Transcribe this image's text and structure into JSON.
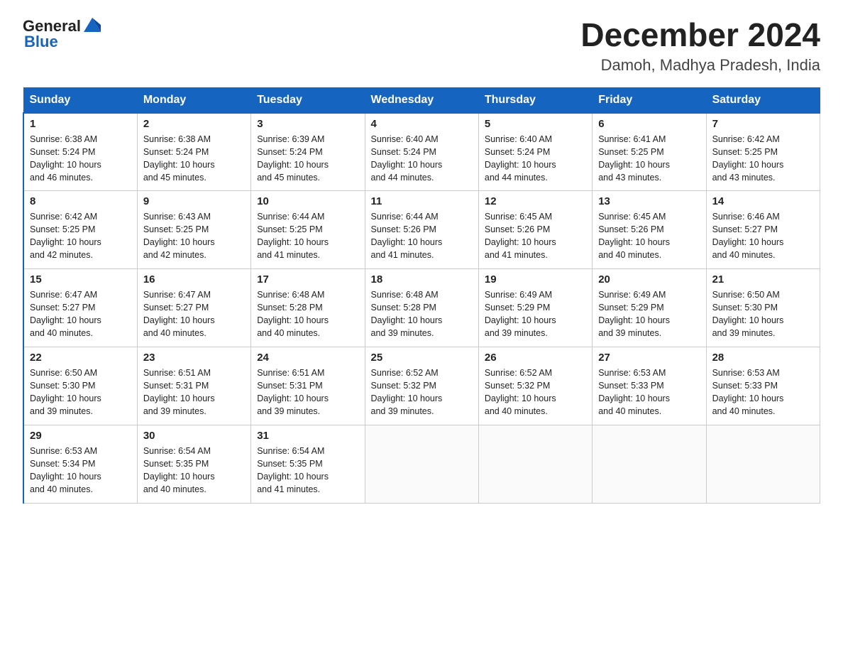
{
  "header": {
    "logo_general": "General",
    "logo_blue": "Blue",
    "title": "December 2024",
    "subtitle": "Damoh, Madhya Pradesh, India"
  },
  "days_of_week": [
    "Sunday",
    "Monday",
    "Tuesday",
    "Wednesday",
    "Thursday",
    "Friday",
    "Saturday"
  ],
  "weeks": [
    [
      {
        "day": "1",
        "sunrise": "6:38 AM",
        "sunset": "5:24 PM",
        "daylight": "10 hours and 46 minutes."
      },
      {
        "day": "2",
        "sunrise": "6:38 AM",
        "sunset": "5:24 PM",
        "daylight": "10 hours and 45 minutes."
      },
      {
        "day": "3",
        "sunrise": "6:39 AM",
        "sunset": "5:24 PM",
        "daylight": "10 hours and 45 minutes."
      },
      {
        "day": "4",
        "sunrise": "6:40 AM",
        "sunset": "5:24 PM",
        "daylight": "10 hours and 44 minutes."
      },
      {
        "day": "5",
        "sunrise": "6:40 AM",
        "sunset": "5:24 PM",
        "daylight": "10 hours and 44 minutes."
      },
      {
        "day": "6",
        "sunrise": "6:41 AM",
        "sunset": "5:25 PM",
        "daylight": "10 hours and 43 minutes."
      },
      {
        "day": "7",
        "sunrise": "6:42 AM",
        "sunset": "5:25 PM",
        "daylight": "10 hours and 43 minutes."
      }
    ],
    [
      {
        "day": "8",
        "sunrise": "6:42 AM",
        "sunset": "5:25 PM",
        "daylight": "10 hours and 42 minutes."
      },
      {
        "day": "9",
        "sunrise": "6:43 AM",
        "sunset": "5:25 PM",
        "daylight": "10 hours and 42 minutes."
      },
      {
        "day": "10",
        "sunrise": "6:44 AM",
        "sunset": "5:25 PM",
        "daylight": "10 hours and 41 minutes."
      },
      {
        "day": "11",
        "sunrise": "6:44 AM",
        "sunset": "5:26 PM",
        "daylight": "10 hours and 41 minutes."
      },
      {
        "day": "12",
        "sunrise": "6:45 AM",
        "sunset": "5:26 PM",
        "daylight": "10 hours and 41 minutes."
      },
      {
        "day": "13",
        "sunrise": "6:45 AM",
        "sunset": "5:26 PM",
        "daylight": "10 hours and 40 minutes."
      },
      {
        "day": "14",
        "sunrise": "6:46 AM",
        "sunset": "5:27 PM",
        "daylight": "10 hours and 40 minutes."
      }
    ],
    [
      {
        "day": "15",
        "sunrise": "6:47 AM",
        "sunset": "5:27 PM",
        "daylight": "10 hours and 40 minutes."
      },
      {
        "day": "16",
        "sunrise": "6:47 AM",
        "sunset": "5:27 PM",
        "daylight": "10 hours and 40 minutes."
      },
      {
        "day": "17",
        "sunrise": "6:48 AM",
        "sunset": "5:28 PM",
        "daylight": "10 hours and 40 minutes."
      },
      {
        "day": "18",
        "sunrise": "6:48 AM",
        "sunset": "5:28 PM",
        "daylight": "10 hours and 39 minutes."
      },
      {
        "day": "19",
        "sunrise": "6:49 AM",
        "sunset": "5:29 PM",
        "daylight": "10 hours and 39 minutes."
      },
      {
        "day": "20",
        "sunrise": "6:49 AM",
        "sunset": "5:29 PM",
        "daylight": "10 hours and 39 minutes."
      },
      {
        "day": "21",
        "sunrise": "6:50 AM",
        "sunset": "5:30 PM",
        "daylight": "10 hours and 39 minutes."
      }
    ],
    [
      {
        "day": "22",
        "sunrise": "6:50 AM",
        "sunset": "5:30 PM",
        "daylight": "10 hours and 39 minutes."
      },
      {
        "day": "23",
        "sunrise": "6:51 AM",
        "sunset": "5:31 PM",
        "daylight": "10 hours and 39 minutes."
      },
      {
        "day": "24",
        "sunrise": "6:51 AM",
        "sunset": "5:31 PM",
        "daylight": "10 hours and 39 minutes."
      },
      {
        "day": "25",
        "sunrise": "6:52 AM",
        "sunset": "5:32 PM",
        "daylight": "10 hours and 39 minutes."
      },
      {
        "day": "26",
        "sunrise": "6:52 AM",
        "sunset": "5:32 PM",
        "daylight": "10 hours and 40 minutes."
      },
      {
        "day": "27",
        "sunrise": "6:53 AM",
        "sunset": "5:33 PM",
        "daylight": "10 hours and 40 minutes."
      },
      {
        "day": "28",
        "sunrise": "6:53 AM",
        "sunset": "5:33 PM",
        "daylight": "10 hours and 40 minutes."
      }
    ],
    [
      {
        "day": "29",
        "sunrise": "6:53 AM",
        "sunset": "5:34 PM",
        "daylight": "10 hours and 40 minutes."
      },
      {
        "day": "30",
        "sunrise": "6:54 AM",
        "sunset": "5:35 PM",
        "daylight": "10 hours and 40 minutes."
      },
      {
        "day": "31",
        "sunrise": "6:54 AM",
        "sunset": "5:35 PM",
        "daylight": "10 hours and 41 minutes."
      },
      null,
      null,
      null,
      null
    ]
  ],
  "labels": {
    "sunrise": "Sunrise:",
    "sunset": "Sunset:",
    "daylight": "Daylight:"
  }
}
